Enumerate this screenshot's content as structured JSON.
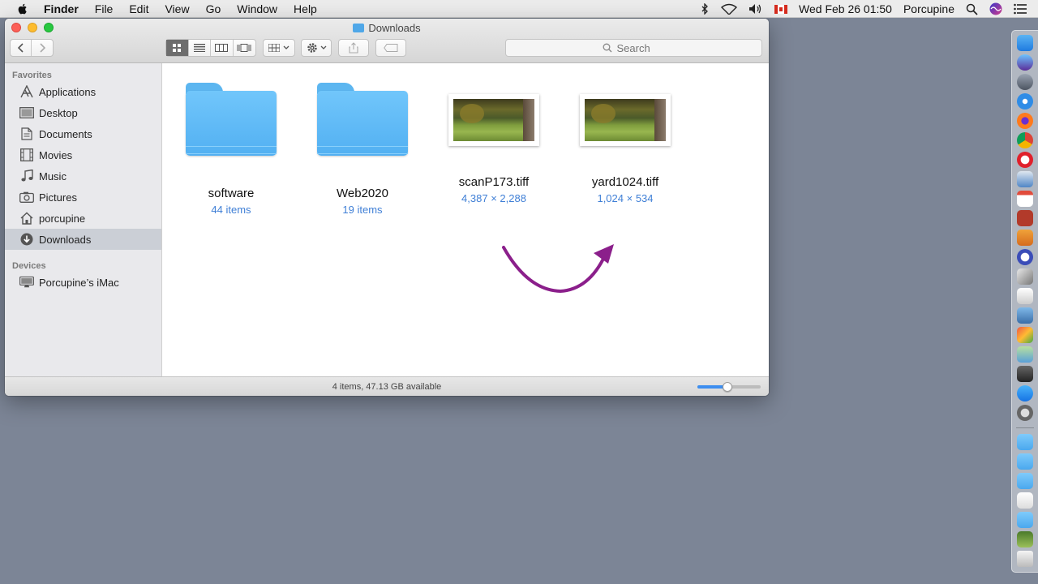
{
  "menubar": {
    "app_name": "Finder",
    "menus": [
      "File",
      "Edit",
      "View",
      "Go",
      "Window",
      "Help"
    ],
    "datetime": "Wed Feb 26  01:50",
    "user": "Porcupine"
  },
  "window": {
    "title": "Downloads",
    "search_placeholder": "Search"
  },
  "sidebar": {
    "favorites_heading": "Favorites",
    "favorites": [
      {
        "label": "Applications",
        "icon": "applications-icon"
      },
      {
        "label": "Desktop",
        "icon": "desktop-icon"
      },
      {
        "label": "Documents",
        "icon": "documents-icon"
      },
      {
        "label": "Movies",
        "icon": "movies-icon"
      },
      {
        "label": "Music",
        "icon": "music-icon"
      },
      {
        "label": "Pictures",
        "icon": "pictures-icon"
      },
      {
        "label": "porcupine",
        "icon": "home-icon"
      },
      {
        "label": "Downloads",
        "icon": "downloads-icon",
        "selected": true
      }
    ],
    "devices_heading": "Devices",
    "devices": [
      {
        "label": "Porcupine’s iMac",
        "icon": "imac-icon"
      }
    ]
  },
  "files": [
    {
      "name": "software",
      "meta": "44 items",
      "kind": "folder"
    },
    {
      "name": "Web2020",
      "meta": "19 items",
      "kind": "folder"
    },
    {
      "name": "scanP173.tiff",
      "meta": "4,387 × 2,288",
      "kind": "image"
    },
    {
      "name": "yard1024.tiff",
      "meta": "1,024 × 534",
      "kind": "image"
    }
  ],
  "statusbar": {
    "text": "4 items, 47.13 GB available",
    "icon_size_fraction": 0.48
  },
  "colors": {
    "accent": "#3d8ef0",
    "annotation_arrow": "#8b1f8b",
    "desktop": "#7c8596"
  }
}
